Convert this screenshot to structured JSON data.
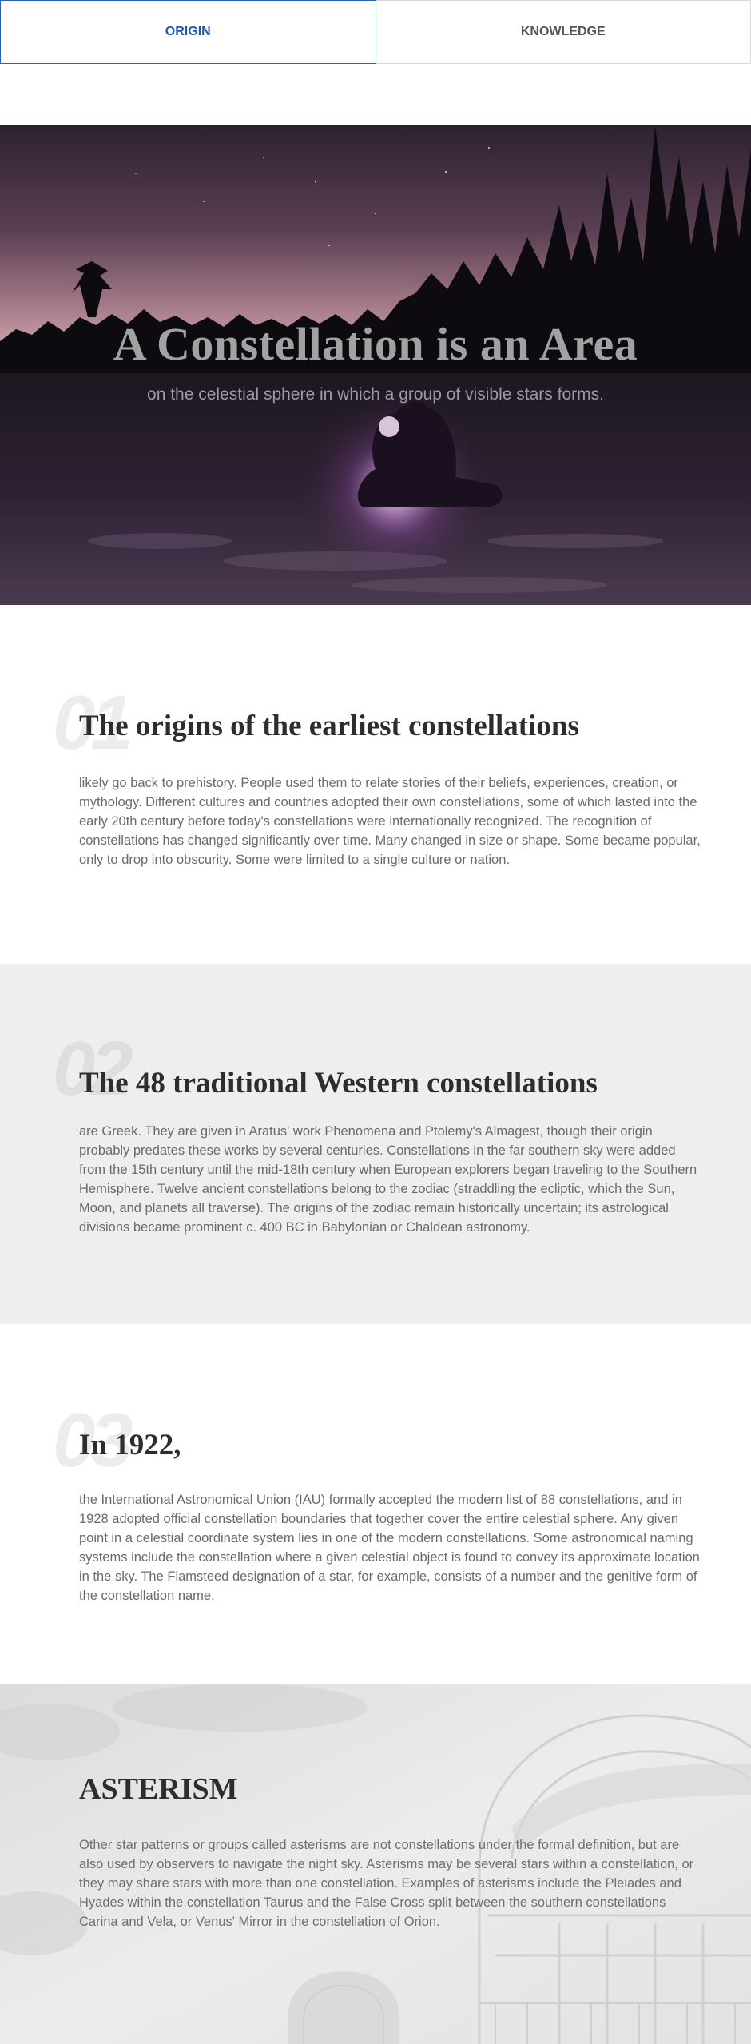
{
  "tabs": [
    {
      "label": "ORIGIN",
      "active": true
    },
    {
      "label": "KNOWLEDGE",
      "active": false
    }
  ],
  "hero": {
    "title": "A Constellation is an Area",
    "subtitle": "on the celestial sphere in which a group of visible stars forms."
  },
  "sections": [
    {
      "number": "01",
      "heading": "The origins of the earliest constellations",
      "body": "likely go back to prehistory. People used them to relate stories of their beliefs, experiences, creation, or mythology. Different cultures and countries adopted their own constellations, some of which lasted into the early 20th century before today's constellations were internationally recognized. The recognition of constellations has changed significantly over time. Many changed in size or shape. Some became popular, only to drop into obscurity. Some were limited to a single culture or nation."
    },
    {
      "number": "02",
      "heading": "The 48 traditional Western constellations",
      "body": "are Greek. They are given in Aratus' work Phenomena and Ptolemy's Almagest, though their origin probably predates these works by several centuries. Constellations in the far southern sky were added from the 15th century until the mid-18th century when European explorers began traveling to the Southern Hemisphere. Twelve ancient constellations belong to the zodiac (straddling the ecliptic, which the Sun, Moon, and planets all traverse). The origins of the zodiac remain historically uncertain; its astrological divisions became prominent c. 400 BC in Babylonian or Chaldean astronomy."
    },
    {
      "number": "03",
      "heading": "In 1922,",
      "body": "the International Astronomical Union (IAU) formally accepted the modern list of 88 constellations, and in 1928 adopted official constellation boundaries that together cover the entire celestial sphere. Any given point in a celestial coordinate system lies in one of the modern constellations. Some astronomical naming systems include the constellation where a given celestial object is found to convey its approximate location in the sky. The Flamsteed designation of a star, for example, consists of a number and the genitive form of the constellation name."
    },
    {
      "heading": "ASTERISM",
      "body": "Other star patterns or groups called asterisms are not constellations under the formal definition, but are also used by observers to navigate the night sky. Asterisms may be several stars within a constellation, or they may share stars with more than one constellation. Examples of asterisms include the Pleiades and Hyades within the constellation Taurus and the False Cross split between the southern constellations Carina and Vela, or Venus' Mirror in the constellation of Orion."
    }
  ],
  "colors": {
    "accent": "#1d57b0",
    "hero_sky_top": "#3b2b3c",
    "hero_sky_glow": "#c49aa6",
    "section_alt_bg": "#eeeeee"
  }
}
